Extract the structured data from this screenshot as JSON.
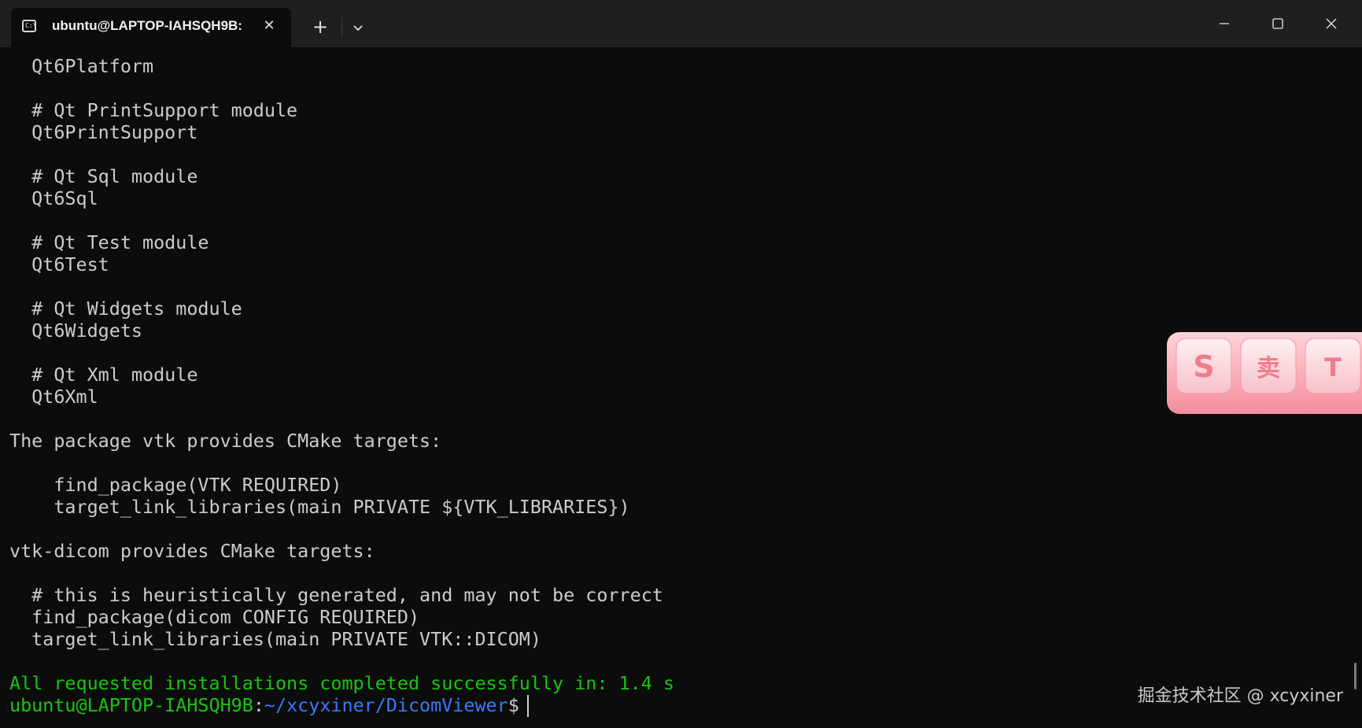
{
  "window": {
    "tab_title": "ubuntu@LAPTOP-IAHSQH9B:",
    "tab_icon_label": "C:\\",
    "icons": {
      "tab": "terminal-icon",
      "tab_close": "close-icon",
      "new_tab": "plus-icon",
      "dropdown": "chevron-down-icon",
      "minimize": "minimize-icon",
      "maximize": "maximize-icon",
      "close": "close-icon"
    },
    "tab_close_glyph": "✕",
    "new_tab_glyph": "+"
  },
  "terminal": {
    "colors": {
      "background": "#0c0c0c",
      "text": "#cccccc",
      "green": "#16c60c",
      "blue": "#3b78ff"
    },
    "lines": [
      "  Qt6Platform",
      "",
      "  # Qt PrintSupport module",
      "  Qt6PrintSupport",
      "",
      "  # Qt Sql module",
      "  Qt6Sql",
      "",
      "  # Qt Test module",
      "  Qt6Test",
      "",
      "  # Qt Widgets module",
      "  Qt6Widgets",
      "",
      "  # Qt Xml module",
      "  Qt6Xml",
      "",
      "The package vtk provides CMake targets:",
      "",
      "    find_package(VTK REQUIRED)",
      "    target_link_libraries(main PRIVATE ${VTK_LIBRARIES})",
      "",
      "vtk-dicom provides CMake targets:",
      "",
      "  # this is heuristically generated, and may not be correct",
      "  find_package(dicom CONFIG REQUIRED)",
      "  target_link_libraries(main PRIVATE VTK::DICOM)",
      ""
    ],
    "success_line": "All requested installations completed successfully in: 1.4 s",
    "prompt": {
      "user_host": "ubuntu@LAPTOP-IAHSQH9B",
      "separator": ":",
      "path": "~/xcyxiner/DicomViewer",
      "symbol": "$ "
    }
  },
  "overlay": {
    "sticker_keys": [
      "S",
      "卖",
      "T"
    ],
    "watermark": "掘金技术社区 @ xcyxiner"
  }
}
